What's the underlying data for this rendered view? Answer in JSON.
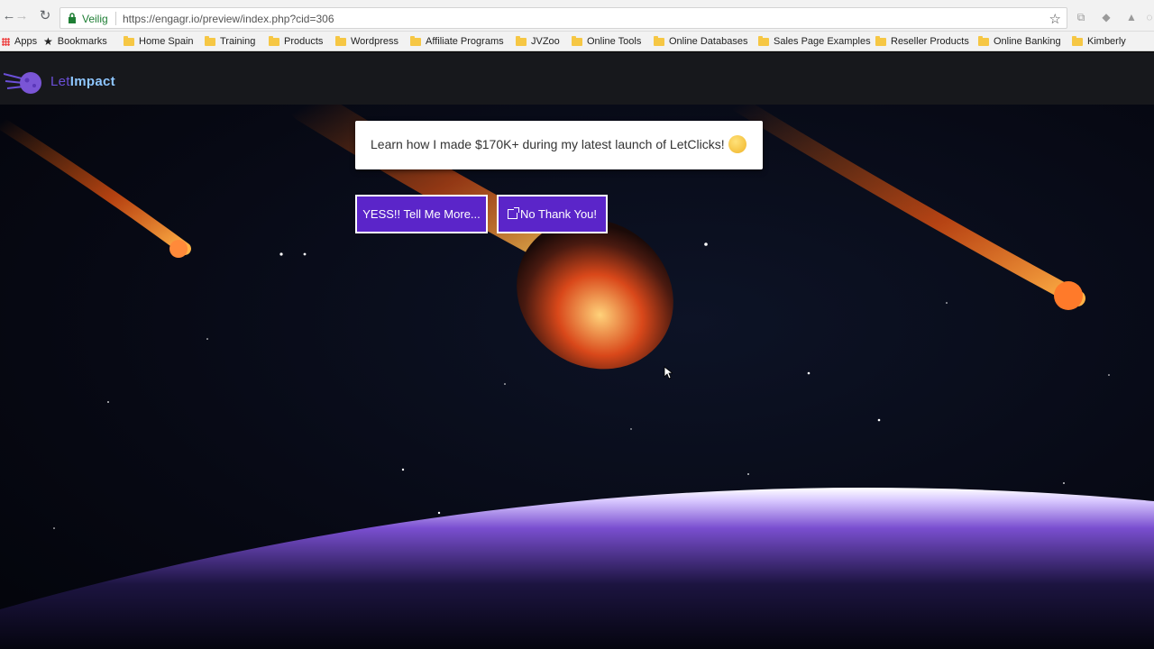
{
  "browser": {
    "secure_label": "Veilig",
    "url": "https://engagr.io/preview/index.php?cid=306",
    "icons": [
      "back-arrow-icon",
      "forward-arrow-icon",
      "reload-icon",
      "lock-icon",
      "star-icon"
    ]
  },
  "bookmarks": {
    "items": [
      {
        "label": "Apps",
        "icon": "apps-grid-icon"
      },
      {
        "label": "Bookmarks",
        "icon": "star-icon"
      },
      {
        "label": "Home Spain",
        "icon": "folder-icon"
      },
      {
        "label": "Training",
        "icon": "folder-icon"
      },
      {
        "label": "Products",
        "icon": "folder-icon"
      },
      {
        "label": "Wordpress",
        "icon": "folder-icon"
      },
      {
        "label": "Affiliate Programs",
        "icon": "folder-icon"
      },
      {
        "label": "JVZoo",
        "icon": "folder-icon"
      },
      {
        "label": "Online Tools",
        "icon": "folder-icon"
      },
      {
        "label": "Online Databases",
        "icon": "folder-icon"
      },
      {
        "label": "Sales Page Examples",
        "icon": "folder-icon"
      },
      {
        "label": "Reseller Products",
        "icon": "folder-icon"
      },
      {
        "label": "Online Banking",
        "icon": "folder-icon"
      },
      {
        "label": "Kimberly",
        "icon": "folder-icon"
      }
    ]
  },
  "site": {
    "logo_let": "Let",
    "logo_impact": "Impact",
    "brand_colors": {
      "header_bg": "#17181c",
      "button_bg": "#5b25c9",
      "logo_let": "#6b4fd8",
      "logo_impact": "#8ec6ff"
    }
  },
  "popup": {
    "message": "Learn how I made $170K+ during my latest launch of LetClicks!",
    "emoji": "thinking-face-icon"
  },
  "buttons": {
    "yes_label": "YESS!! Tell Me More...",
    "no_label": "No Thank You!",
    "no_icon": "external-link-icon"
  }
}
